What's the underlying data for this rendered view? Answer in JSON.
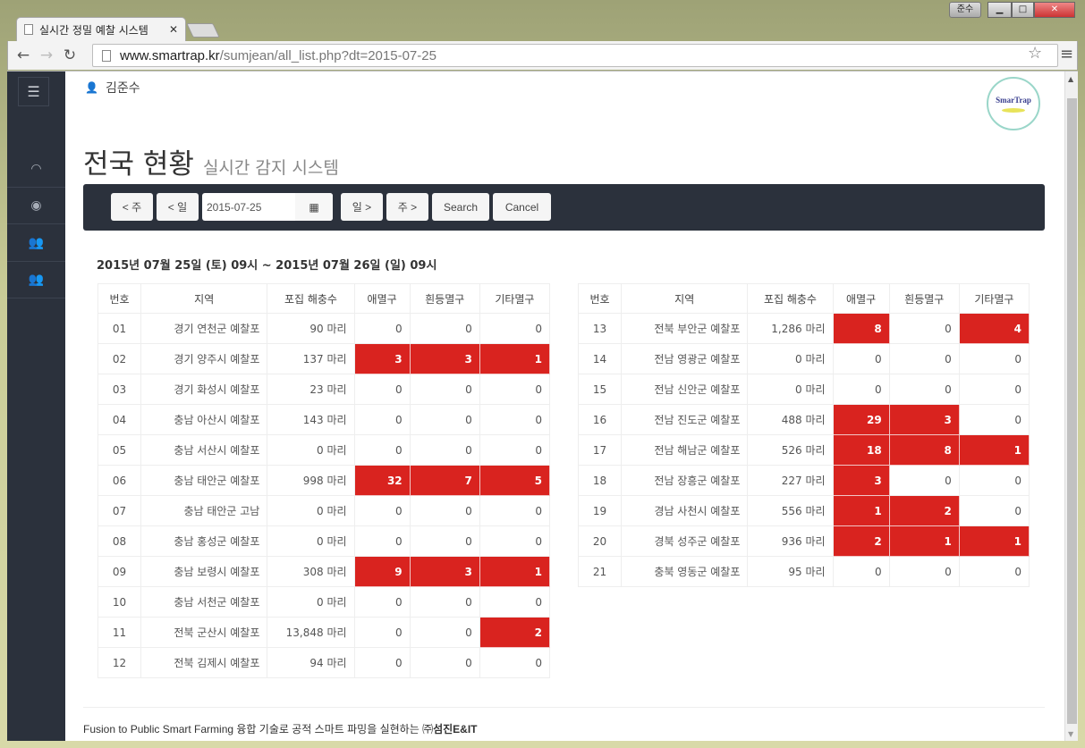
{
  "browser": {
    "tab_title": "실시간 정밀 예찰 시스템",
    "url_host": "www.smartrap.kr",
    "url_path": "/sumjean/all_list.php?dt=2015-07-25",
    "user_badge": "준수"
  },
  "sidebar": {
    "items": [
      {
        "icon": "dashboard-icon"
      },
      {
        "icon": "eye-icon"
      },
      {
        "icon": "users-icon"
      },
      {
        "icon": "users-icon"
      }
    ]
  },
  "header": {
    "user_name": "김준수",
    "logo_text": "SmarTrap",
    "title": "전국 현황",
    "subtitle": "실시간 감지 시스템"
  },
  "filter": {
    "prev_week": "< 주",
    "prev_day": "< 일",
    "date_value": "2015-07-25",
    "next_day": "일 >",
    "next_week": "주 >",
    "search": "Search",
    "cancel": "Cancel"
  },
  "period": "2015년 07월 25일 (토) 09시 ~ 2015년 07월 26일 (일) 09시",
  "columns": [
    "번호",
    "지역",
    "포집 해충수",
    "애멸구",
    "흰등멸구",
    "기타멸구"
  ],
  "highlight_color": "#d9231f",
  "left_rows": [
    {
      "no": "01",
      "region": "경기 연천군 예찰포",
      "count": "90 마리",
      "a": 0,
      "b": 0,
      "c": 0
    },
    {
      "no": "02",
      "region": "경기 양주시 예찰포",
      "count": "137 마리",
      "a": 3,
      "b": 3,
      "c": 1
    },
    {
      "no": "03",
      "region": "경기 화성시 예찰포",
      "count": "23 마리",
      "a": 0,
      "b": 0,
      "c": 0
    },
    {
      "no": "04",
      "region": "충남 아산시 예찰포",
      "count": "143 마리",
      "a": 0,
      "b": 0,
      "c": 0
    },
    {
      "no": "05",
      "region": "충남 서산시 예찰포",
      "count": "0 마리",
      "a": 0,
      "b": 0,
      "c": 0
    },
    {
      "no": "06",
      "region": "충남 태안군 예찰포",
      "count": "998 마리",
      "a": 32,
      "b": 7,
      "c": 5
    },
    {
      "no": "07",
      "region": "충남 태안군 고남",
      "count": "0 마리",
      "a": 0,
      "b": 0,
      "c": 0
    },
    {
      "no": "08",
      "region": "충남 홍성군 예찰포",
      "count": "0 마리",
      "a": 0,
      "b": 0,
      "c": 0
    },
    {
      "no": "09",
      "region": "충남 보령시 예찰포",
      "count": "308 마리",
      "a": 9,
      "b": 3,
      "c": 1
    },
    {
      "no": "10",
      "region": "충남 서천군 예찰포",
      "count": "0 마리",
      "a": 0,
      "b": 0,
      "c": 0
    },
    {
      "no": "11",
      "region": "전북 군산시 예찰포",
      "count": "13,848 마리",
      "a": 0,
      "b": 0,
      "c": 2
    },
    {
      "no": "12",
      "region": "전북 김제시 예찰포",
      "count": "94 마리",
      "a": 0,
      "b": 0,
      "c": 0
    }
  ],
  "right_rows": [
    {
      "no": "13",
      "region": "전북 부안군 예찰포",
      "count": "1,286 마리",
      "a": 8,
      "b": 0,
      "c": 4
    },
    {
      "no": "14",
      "region": "전남 영광군 예찰포",
      "count": "0 마리",
      "a": 0,
      "b": 0,
      "c": 0
    },
    {
      "no": "15",
      "region": "전남 신안군 예찰포",
      "count": "0 마리",
      "a": 0,
      "b": 0,
      "c": 0
    },
    {
      "no": "16",
      "region": "전남 진도군 예찰포",
      "count": "488 마리",
      "a": 29,
      "b": 3,
      "c": 0
    },
    {
      "no": "17",
      "region": "전남 해남군 예찰포",
      "count": "526 마리",
      "a": 18,
      "b": 8,
      "c": 1
    },
    {
      "no": "18",
      "region": "전남 장흥군 예찰포",
      "count": "227 마리",
      "a": 3,
      "b": 0,
      "c": 0
    },
    {
      "no": "19",
      "region": "경남 사천시 예찰포",
      "count": "556 마리",
      "a": 1,
      "b": 2,
      "c": 0
    },
    {
      "no": "20",
      "region": "경북 성주군 예찰포",
      "count": "936 마리",
      "a": 2,
      "b": 1,
      "c": 1
    },
    {
      "no": "21",
      "region": "충북 영동군 예찰포",
      "count": "95 마리",
      "a": 0,
      "b": 0,
      "c": 0
    }
  ],
  "footer": {
    "text": "Fusion to Public Smart Farming 융합 기술로 공적 스마트 파밍을 실현하는 ㈜",
    "company": "섬진E&IT"
  }
}
